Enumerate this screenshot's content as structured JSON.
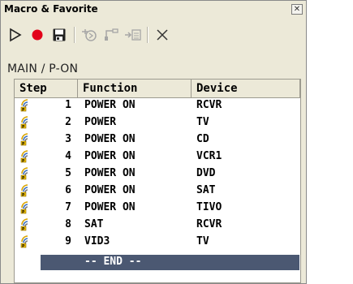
{
  "window": {
    "title": "Macro & Favorite",
    "close_glyph": "✕"
  },
  "toolbar": {
    "buttons": [
      {
        "name": "play-icon",
        "enabled": true
      },
      {
        "name": "record-icon",
        "enabled": true,
        "color": "#e2001a"
      },
      {
        "name": "save-icon",
        "enabled": true
      },
      {
        "name": "insert-step-icon",
        "enabled": false
      },
      {
        "name": "add-step-icon",
        "enabled": false
      },
      {
        "name": "move-step-icon",
        "enabled": false
      },
      {
        "name": "delete-icon",
        "enabled": true
      }
    ]
  },
  "path": "MAIN / P-ON",
  "table": {
    "columns": [
      "Step",
      "Function",
      "Device"
    ],
    "rows": [
      {
        "step": "1",
        "function": "POWER ON",
        "device": "RCVR"
      },
      {
        "step": "2",
        "function": "POWER",
        "device": "TV"
      },
      {
        "step": "3",
        "function": "POWER ON",
        "device": "CD"
      },
      {
        "step": "4",
        "function": "POWER ON",
        "device": "VCR1"
      },
      {
        "step": "5",
        "function": "POWER ON",
        "device": "DVD"
      },
      {
        "step": "6",
        "function": "POWER ON",
        "device": "SAT"
      },
      {
        "step": "7",
        "function": "POWER ON",
        "device": "TIVO"
      },
      {
        "step": "8",
        "function": "SAT",
        "device": "RCVR"
      },
      {
        "step": "9",
        "function": "VID3",
        "device": "TV"
      }
    ],
    "end_label": "-- END --",
    "selection_color": "#4b5872"
  }
}
